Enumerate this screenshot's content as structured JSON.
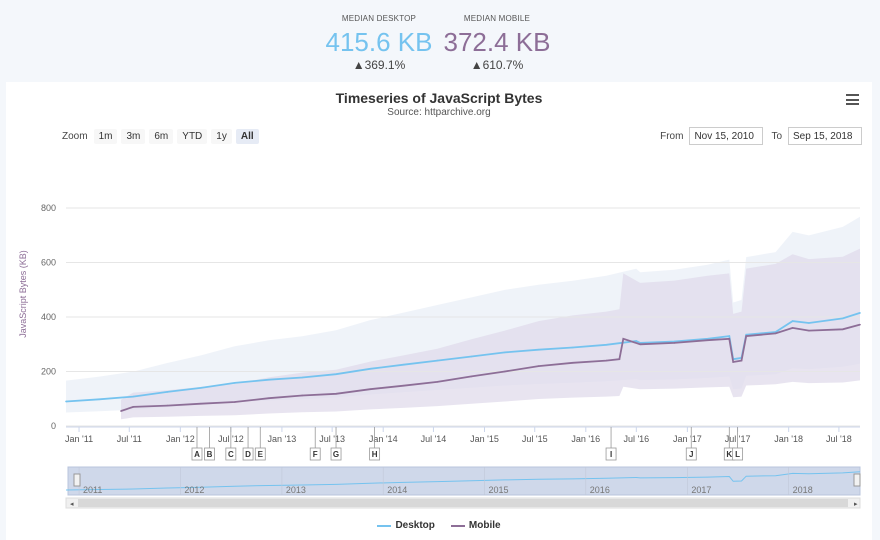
{
  "summary": {
    "desktop": {
      "label": "MEDIAN DESKTOP",
      "value": "415.6 KB",
      "change": "▲369.1%"
    },
    "mobile": {
      "label": "MEDIAN MOBILE",
      "value": "372.4 KB",
      "change": "▲610.7%"
    }
  },
  "toolbar": {
    "zoom_label": "Zoom",
    "zoom_buttons": [
      "1m",
      "3m",
      "6m",
      "YTD",
      "1y",
      "All"
    ],
    "active_zoom": "All",
    "from_label": "From",
    "from_value": "Nov 15, 2010",
    "to_label": "To",
    "to_value": "Sep 15, 2018"
  },
  "menu_icon": "hamburger-menu-icon",
  "colors": {
    "desktop": "#75c3ef",
    "mobile": "#8d6e97",
    "band_desktop": "#e8eef6",
    "band_mobile": "#e0dbeb"
  },
  "chart_data": {
    "type": "line",
    "title": "Timeseries of JavaScript Bytes",
    "subtitle": "Source: httparchive.org",
    "ylabel": "JavaScript Bytes (KB)",
    "ylim": [
      0,
      800
    ],
    "yticks": [
      0,
      200,
      400,
      600,
      800
    ],
    "xlim": [
      "2010-11-15",
      "2018-09-15"
    ],
    "xticks": [
      "Jan '11",
      "Jul '11",
      "Jan '12",
      "Jul '12",
      "Jan '13",
      "Jul '13",
      "Jan '14",
      "Jul '14",
      "Jan '15",
      "Jul '15",
      "Jan '16",
      "Jul '16",
      "Jan '17",
      "Jul '17",
      "Jan '18",
      "Jul '18"
    ],
    "navigator_labels": [
      "2011",
      "2012",
      "2013",
      "2014",
      "2015",
      "2016",
      "2017",
      "2018"
    ],
    "grid": true,
    "legend": "bottom",
    "series": [
      {
        "name": "Desktop",
        "x": [
          "2010-11-15",
          "2011-03-15",
          "2011-07-15",
          "2011-11-15",
          "2012-03-15",
          "2012-07-15",
          "2012-11-15",
          "2013-03-15",
          "2013-07-15",
          "2013-11-15",
          "2014-03-15",
          "2014-07-15",
          "2014-11-15",
          "2015-03-15",
          "2015-07-15",
          "2015-11-15",
          "2016-03-15",
          "2016-07-01",
          "2016-07-15",
          "2016-11-15",
          "2017-03-15",
          "2017-06-01",
          "2017-06-15",
          "2017-07-15",
          "2017-08-01",
          "2017-11-15",
          "2018-01-15",
          "2018-03-15",
          "2018-07-15",
          "2018-09-15"
        ],
        "y": [
          90,
          98,
          108,
          125,
          140,
          158,
          170,
          178,
          190,
          210,
          225,
          240,
          255,
          270,
          280,
          288,
          298,
          312,
          305,
          310,
          320,
          330,
          245,
          250,
          335,
          345,
          385,
          378,
          395,
          415
        ]
      },
      {
        "name": "Mobile",
        "x": [
          "2011-06-01",
          "2011-07-15",
          "2011-11-15",
          "2012-03-15",
          "2012-07-15",
          "2012-11-15",
          "2013-03-15",
          "2013-07-15",
          "2013-11-15",
          "2014-03-15",
          "2014-07-15",
          "2014-11-15",
          "2015-03-15",
          "2015-07-15",
          "2015-11-15",
          "2016-03-15",
          "2016-05-01",
          "2016-05-15",
          "2016-07-15",
          "2016-11-15",
          "2017-03-15",
          "2017-06-01",
          "2017-06-15",
          "2017-07-15",
          "2017-08-01",
          "2017-11-15",
          "2018-01-15",
          "2018-03-15",
          "2018-07-15",
          "2018-09-15"
        ],
        "y": [
          55,
          70,
          75,
          82,
          88,
          102,
          112,
          118,
          135,
          148,
          162,
          182,
          200,
          220,
          232,
          240,
          245,
          320,
          300,
          305,
          315,
          320,
          235,
          240,
          330,
          340,
          360,
          350,
          355,
          372
        ]
      }
    ],
    "annotations": [
      {
        "label": "A",
        "x": "2012-03-01"
      },
      {
        "label": "B",
        "x": "2012-04-15"
      },
      {
        "label": "C",
        "x": "2012-07-01"
      },
      {
        "label": "D",
        "x": "2012-09-01"
      },
      {
        "label": "E",
        "x": "2012-10-15"
      },
      {
        "label": "F",
        "x": "2013-05-01"
      },
      {
        "label": "G",
        "x": "2013-07-15"
      },
      {
        "label": "H",
        "x": "2013-12-01"
      },
      {
        "label": "I",
        "x": "2016-04-01"
      },
      {
        "label": "J",
        "x": "2017-01-15"
      },
      {
        "label": "K",
        "x": "2017-06-01"
      },
      {
        "label": "L",
        "x": "2017-07-01"
      }
    ]
  }
}
